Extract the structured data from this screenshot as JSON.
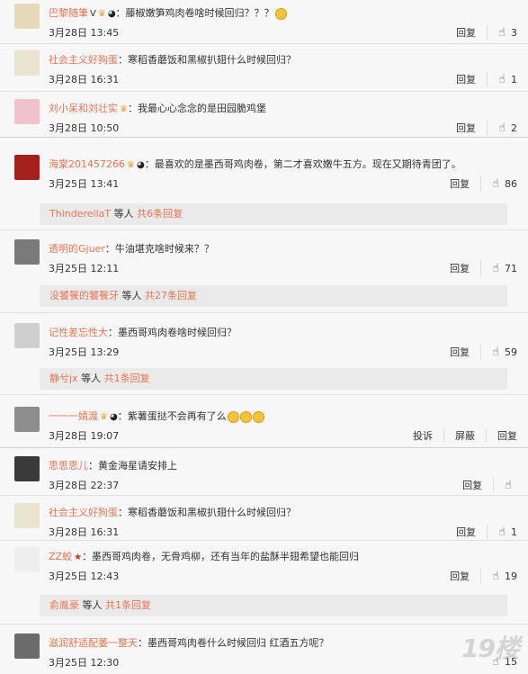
{
  "comments": [
    {
      "name": "巴黎随筆",
      "badges": [
        "V",
        "crown",
        "panda"
      ],
      "text": "：藤椒嫩笋鸡肉卷啥时候回归？？？",
      "emoji": 1,
      "time": "3月28日 13:45",
      "actions": [
        "回复"
      ],
      "likes": "3",
      "avatar_color": "#e6d9b8"
    },
    {
      "name": "社会主义好狗蛋",
      "badges": [],
      "text": "：寒稻香蘑饭和黑椒扒翅什么时候回归？",
      "emoji": 0,
      "time": "3月28日 16:31",
      "actions": [
        "回复"
      ],
      "likes": "1",
      "avatar_color": "#e9e4d0"
    },
    {
      "name": "刘小呆和刘壮实",
      "badges": [
        "crown"
      ],
      "text": "：我最心心念念的是田园脆鸡堡",
      "emoji": 0,
      "time": "3月28日 10:50",
      "actions": [
        "回复"
      ],
      "likes": "2",
      "avatar_color": "#f0c2cc"
    },
    {
      "name": "海棠201457266",
      "badges": [
        "crown",
        "panda"
      ],
      "text": "：最喜欢的是墨西哥鸡肉卷，第二才喜欢嫩牛五方。现在又期待青团了。",
      "emoji": 0,
      "time": "3月25日 13:41",
      "actions": [
        "回复"
      ],
      "likes": "86",
      "avatar_color": "#a5211d"
    },
    {
      "name": "透明的Gjuer",
      "badges": [],
      "text": "：牛油堪克啥时候来？？",
      "emoji": 0,
      "time": "3月25日 12:11",
      "actions": [
        "回复"
      ],
      "likes": "71",
      "avatar_color": "#7a7a7a"
    },
    {
      "name": "记性差忘性大",
      "badges": [],
      "text": "：墨西哥鸡肉卷啥时候回归？",
      "emoji": 0,
      "time": "3月25日 13:29",
      "actions": [
        "回复"
      ],
      "likes": "59",
      "avatar_color": "#cfcfcf"
    },
    {
      "name": "一一一婧渡",
      "badges": [
        "crown",
        "panda"
      ],
      "text": "：紫薯蛋挞不会再有了么",
      "emoji": 3,
      "time": "3月28日 19:07",
      "actions": [
        "投诉",
        "屏蔽",
        "回复"
      ],
      "likes": "",
      "avatar_color": "#8d8d8d"
    },
    {
      "name": "思思思儿",
      "badges": [],
      "text": "：黄金海星请安排上",
      "emoji": 0,
      "time": "3月28日 22:37",
      "actions": [
        "回复"
      ],
      "likes": "",
      "avatar_color": "#3a3a3a"
    },
    {
      "name": "社会主义好狗蛋",
      "badges": [],
      "text": "：寒稻香蘑饭和黑椒扒翅什么时候回归？",
      "emoji": 0,
      "time": "3月28日 16:31",
      "actions": [
        "回复"
      ],
      "likes": "1",
      "avatar_color": "#e9e4d0"
    },
    {
      "name": "ZZ蛟",
      "badges": [
        "star"
      ],
      "text": "：墨西哥鸡肉卷，无骨鸡柳，还有当年的盐酥半翅希望也能回归",
      "emoji": 0,
      "time": "3月25日 12:43",
      "actions": [
        "回复"
      ],
      "likes": "19",
      "avatar_color": "#eeeeee"
    },
    {
      "name": "滋润舒适配萎一整天",
      "badges": [],
      "text": "：墨西哥鸡肉卷什么时候回归 红酒五方呢？",
      "emoji": 0,
      "time": "3月25日 12:30",
      "actions": [],
      "likes": "15",
      "avatar_color": "#6b6b6b"
    }
  ],
  "subreplies": [
    {
      "user": "ThinderellaT",
      "mid": " 等人 ",
      "count": "共6条回复"
    },
    {
      "user": "没饕餮的饕餮牙",
      "mid": " 等人 ",
      "count": "共27条回复"
    },
    {
      "user": "静兮jx",
      "mid": " 等人 ",
      "count": "共1条回复"
    },
    {
      "user": "俞胤豪",
      "mid": " 等人 ",
      "count": "共1条回复"
    }
  ],
  "watermark": "19楼"
}
